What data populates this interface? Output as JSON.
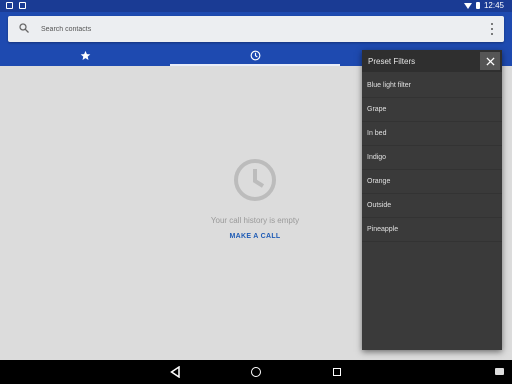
{
  "status_bar": {
    "time": "12:45"
  },
  "search": {
    "placeholder": "Search contacts",
    "value": ""
  },
  "tabs": [
    {
      "icon": "star-icon",
      "selected": false
    },
    {
      "icon": "clock-icon",
      "selected": true
    }
  ],
  "empty_state": {
    "message": "Your call history is empty",
    "action": "MAKE A CALL"
  },
  "preset_filters": {
    "title": "Preset Filters",
    "items": [
      "Blue light filter",
      "Grape",
      "In bed",
      "Indigo",
      "Orange",
      "Outside",
      "Pineapple"
    ]
  },
  "colors": {
    "status_bar": "#1a3b94",
    "app_bar": "#1e4ab0",
    "accent": "#1e5bb5",
    "panel": "#3a3a3a"
  }
}
